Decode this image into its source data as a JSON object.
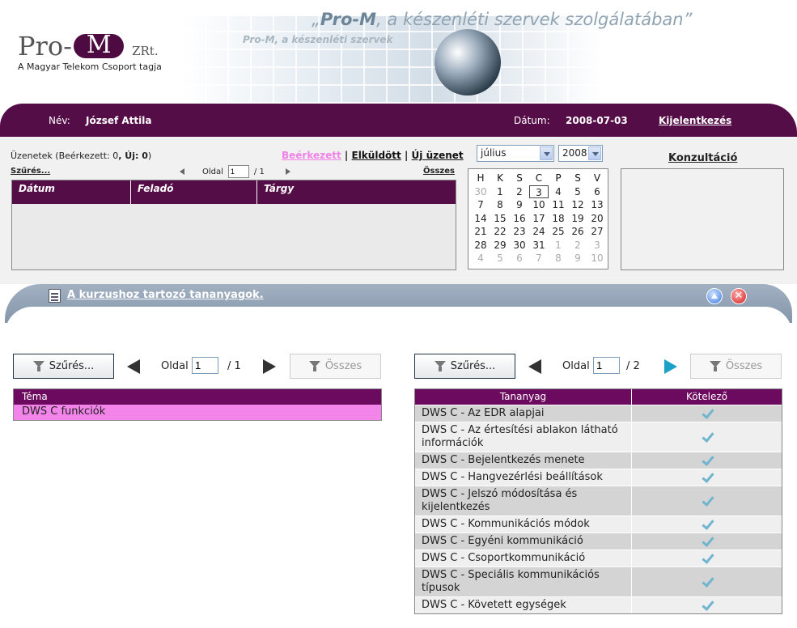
{
  "header": {
    "logo_text": "Pro-",
    "logo_mark": "M",
    "logo_suffix": "ZRt.",
    "logo_subtitle": "A Magyar Telekom Csoport tagja",
    "slogan_brand": "Pro-M",
    "slogan_rest": ", a készenléti szervek szolgálatában",
    "slogan_open": "„",
    "slogan_close": "”",
    "slogan_ghost": "Pro-M, a készenléti szervek"
  },
  "userbar": {
    "name_label": "Név:",
    "name_value": "József Attila",
    "date_label": "Dátum:",
    "date_value": "2008-07-03",
    "logout_label": "Kijelentkezés"
  },
  "messages": {
    "title_prefix": "Üzenetek (Beérkezett: ",
    "received_count": "0",
    "new_label": ", Új: ",
    "new_count": "0",
    "title_suffix": ")",
    "tab_inbox": "Beérkezett",
    "tab_sent": "Elküldött",
    "tab_new": "Új üzenet",
    "separator": "|",
    "filter_label": "Szűrés...",
    "page_label": "Oldal",
    "page_value": "1",
    "page_total": "/ 1",
    "all_label": "Összes",
    "columns": [
      "Dátum",
      "Feladó",
      "Tárgy"
    ]
  },
  "calendar": {
    "month": "július",
    "year": "2008",
    "weekdays": [
      "H",
      "K",
      "S",
      "C",
      "P",
      "S",
      "V"
    ],
    "days": [
      {
        "d": "30",
        "dim": true
      },
      {
        "d": "1"
      },
      {
        "d": "2"
      },
      {
        "d": "3",
        "today": true
      },
      {
        "d": "4"
      },
      {
        "d": "5"
      },
      {
        "d": "6"
      },
      {
        "d": "7"
      },
      {
        "d": "8"
      },
      {
        "d": "9"
      },
      {
        "d": "10"
      },
      {
        "d": "11"
      },
      {
        "d": "12"
      },
      {
        "d": "13"
      },
      {
        "d": "14"
      },
      {
        "d": "15"
      },
      {
        "d": "16"
      },
      {
        "d": "17"
      },
      {
        "d": "18"
      },
      {
        "d": "19"
      },
      {
        "d": "20"
      },
      {
        "d": "21"
      },
      {
        "d": "22"
      },
      {
        "d": "23"
      },
      {
        "d": "24"
      },
      {
        "d": "25"
      },
      {
        "d": "26"
      },
      {
        "d": "27"
      },
      {
        "d": "28"
      },
      {
        "d": "29"
      },
      {
        "d": "30"
      },
      {
        "d": "31"
      },
      {
        "d": "1",
        "dim": true
      },
      {
        "d": "2",
        "dim": true
      },
      {
        "d": "3",
        "dim": true
      },
      {
        "d": "4",
        "dim": true
      },
      {
        "d": "5",
        "dim": true
      },
      {
        "d": "6",
        "dim": true
      },
      {
        "d": "7",
        "dim": true
      },
      {
        "d": "8",
        "dim": true
      },
      {
        "d": "9",
        "dim": true
      },
      {
        "d": "10",
        "dim": true
      }
    ]
  },
  "consultation": {
    "title": "Konzultáció"
  },
  "panel": {
    "title": "A kurzushoz tartozó tananyagok.",
    "close_glyph": "✕",
    "left": {
      "filter_label": "Szűrés...",
      "page_label": "Oldal",
      "page_value": "1",
      "page_total": "/ 1",
      "all_label": "Összes",
      "column": "Téma",
      "rows": [
        "DWS C funkciók"
      ]
    },
    "right": {
      "filter_label": "Szűrés...",
      "page_label": "Oldal",
      "page_value": "1",
      "page_total": "/ 2",
      "all_label": "Összes",
      "col_material": "Tananyag",
      "col_required": "Kötelező",
      "rows": [
        {
          "title": "DWS C - Az EDR alapjai",
          "required": true
        },
        {
          "title": "DWS C - Az értesítési ablakon látható információk",
          "required": true
        },
        {
          "title": "DWS C - Bejelentkezés menete",
          "required": true
        },
        {
          "title": "DWS C - Hangvezérlési beállítások",
          "required": true
        },
        {
          "title": "DWS C - Jelszó módosítása és kijelentkezés",
          "required": true
        },
        {
          "title": "DWS C - Kommunikációs módok",
          "required": true
        },
        {
          "title": "DWS C - Egyéni kommunikáció",
          "required": true
        },
        {
          "title": "DWS C - Csoportkommunikáció",
          "required": true
        },
        {
          "title": "DWS C - Speciális kommunikációs típusok",
          "required": true
        },
        {
          "title": "DWS C - Követett egységek",
          "required": true
        }
      ]
    }
  },
  "colors": {
    "brand": "#550d47",
    "highlight": "#f384ea",
    "panel_head": "#8f9fb2"
  }
}
